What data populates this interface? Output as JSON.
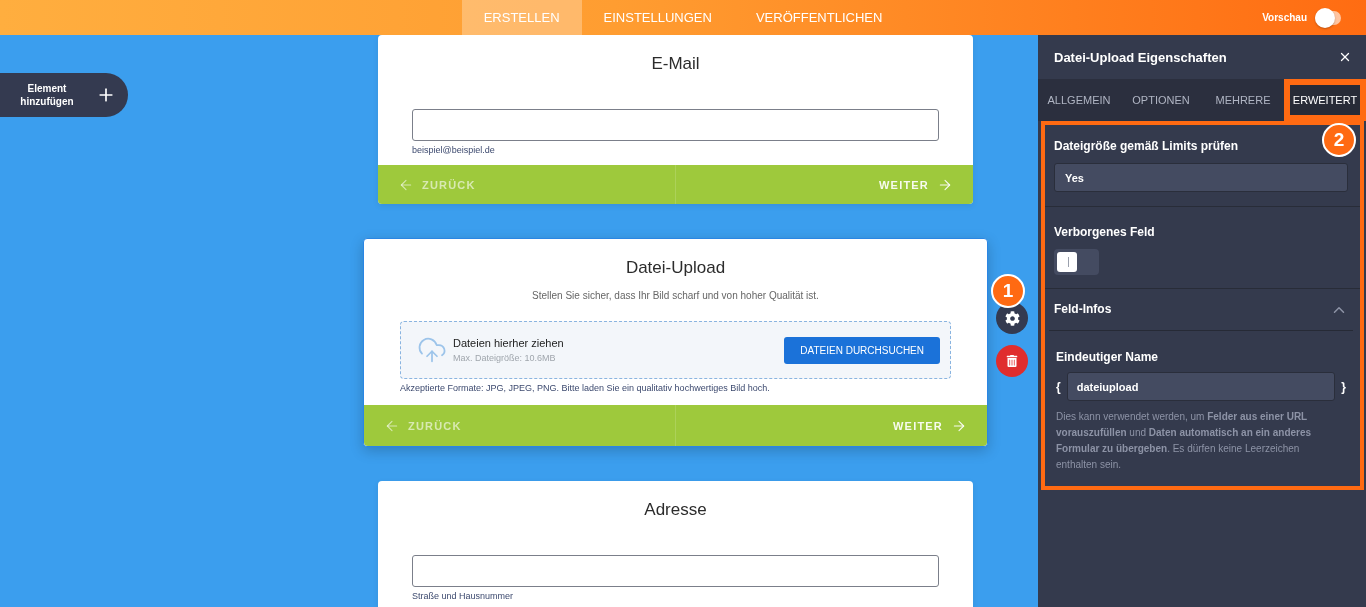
{
  "top_bar": {
    "tabs": [
      {
        "label": "ERSTELLEN",
        "selected": true
      },
      {
        "label": "EINSTELLUNGEN",
        "selected": false
      },
      {
        "label": "VERÖFFENTLICHEN",
        "selected": false
      }
    ],
    "preview": {
      "label": "Vorschau",
      "on": false
    }
  },
  "add_element_button": {
    "label": "Element hinzufügen"
  },
  "form_cards": [
    {
      "kind": "text_input",
      "title": "E-Mail",
      "sublabel": "beispiel@beispiel.de",
      "footer": {
        "back_label": "ZURÜCK",
        "next_label": "WEITER"
      },
      "selected": false
    },
    {
      "kind": "file_upload",
      "title": "Datei-Upload",
      "description": "Stellen Sie sicher, dass Ihr Bild scharf und von hoher Qualität ist.",
      "dropzone": {
        "heading": "Dateien hierher ziehen",
        "limit": "Max. Dateigröße: 10.6MB",
        "button": "DATEIEN DURCHSUCHEN"
      },
      "note": "Akzeptierte Formate: JPG, JPEG, PNG. Bitte laden Sie ein qualitativ hochwertiges Bild hoch.",
      "footer": {
        "back_label": "ZURÜCK",
        "next_label": "WEITER"
      },
      "selected": true,
      "badge": "1"
    },
    {
      "kind": "text_input",
      "title": "Adresse",
      "sublabel": "Straße und Hausnummer",
      "selected": false
    }
  ],
  "properties_panel": {
    "title": "Datei-Upload Eigenschaften",
    "tabs": [
      {
        "label": "ALLGEMEIN",
        "selected": false,
        "highlighted": false
      },
      {
        "label": "OPTIONEN",
        "selected": false,
        "highlighted": false
      },
      {
        "label": "MEHRERE",
        "selected": false,
        "highlighted": false
      },
      {
        "label": "ERWEITERT",
        "selected": true,
        "highlighted": true
      }
    ],
    "highlighted": true,
    "badge": "2",
    "settings": [
      {
        "kind": "select",
        "label": "Dateigröße gemäß Limits prüfen",
        "value": "Yes"
      },
      {
        "kind": "toggle",
        "label": "Verborgenes Feld",
        "on": false
      }
    ],
    "section": {
      "title": "Feld-Infos",
      "expanded": true,
      "field": {
        "label": "Eindeutiger Name",
        "prefix": "{",
        "value": "dateiupload",
        "suffix": "}"
      },
      "help": "Dies kann verwendet werden, um **Felder aus einer URL vorauszufüllen** und **Daten automatisch an ein anderes Formular zu übergeben**. Es dürfen keine Leerzeichen enthalten sein."
    }
  }
}
